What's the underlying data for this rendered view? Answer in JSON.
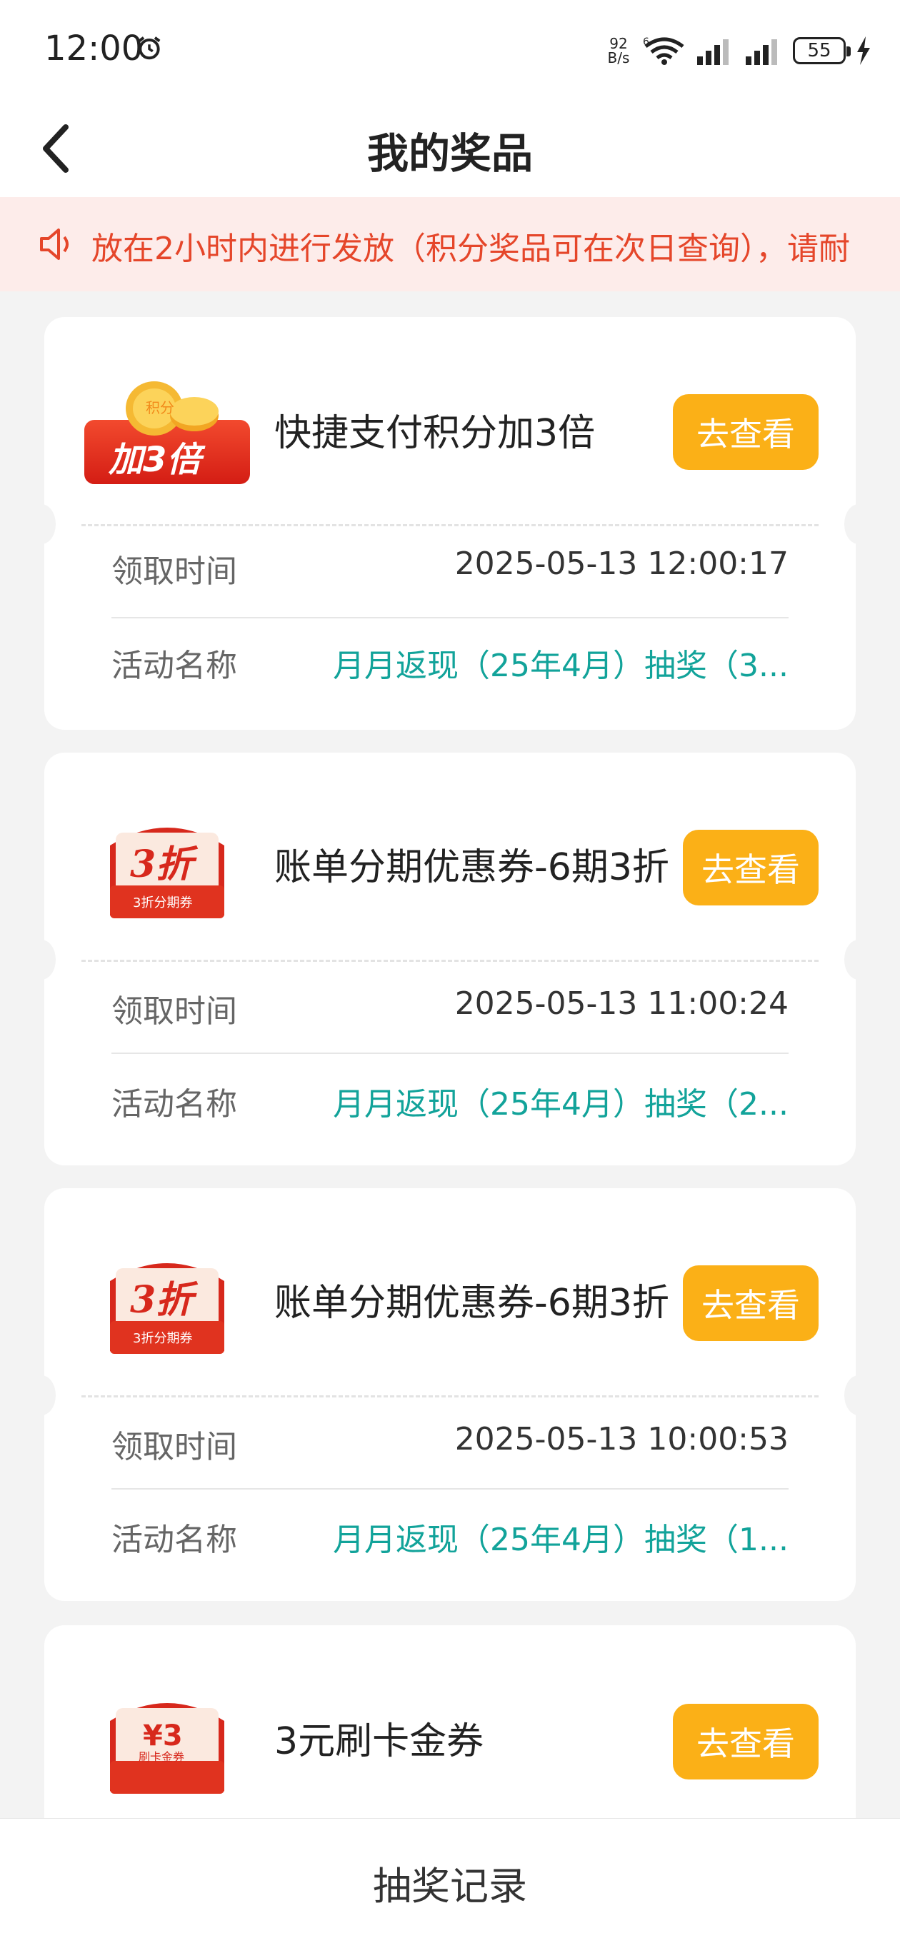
{
  "status_bar": {
    "time": "12:00",
    "net_speed_top": "92",
    "net_speed_bottom": "B/s",
    "wifi_badge": "6",
    "battery": "55"
  },
  "header": {
    "title": "我的奖品"
  },
  "notice": {
    "text": "放在2小时内进行发放（积分奖品可在次日查询），请耐"
  },
  "labels": {
    "claim_time": "领取时间",
    "activity_name": "活动名称",
    "view_button": "去查看"
  },
  "prizes": [
    {
      "title": "快捷支付积分加3倍",
      "image_text": "加3倍",
      "image_badge": "积分",
      "claim_time": "2025-05-13 12:00:17",
      "activity": "月月返现（25年4月）抽奖（3..."
    },
    {
      "title": "账单分期优惠券-6期3折",
      "image_text": "3折",
      "image_sub": "3折分期券",
      "claim_time": "2025-05-13 11:00:24",
      "activity": "月月返现（25年4月）抽奖（2..."
    },
    {
      "title": "账单分期优惠券-6期3折",
      "image_text": "3折",
      "image_sub": "3折分期券",
      "claim_time": "2025-05-13 10:00:53",
      "activity": "月月返现（25年4月）抽奖（1..."
    },
    {
      "title": "3元刷卡金券",
      "image_text": "¥3",
      "image_sub": "刷卡金券"
    }
  ],
  "bottom": {
    "label": "抽奖记录"
  },
  "colors": {
    "accent_button": "#fbb017",
    "activity_text": "#12a39a",
    "notice_text": "#e5462a",
    "notice_bg": "#fdecea"
  }
}
